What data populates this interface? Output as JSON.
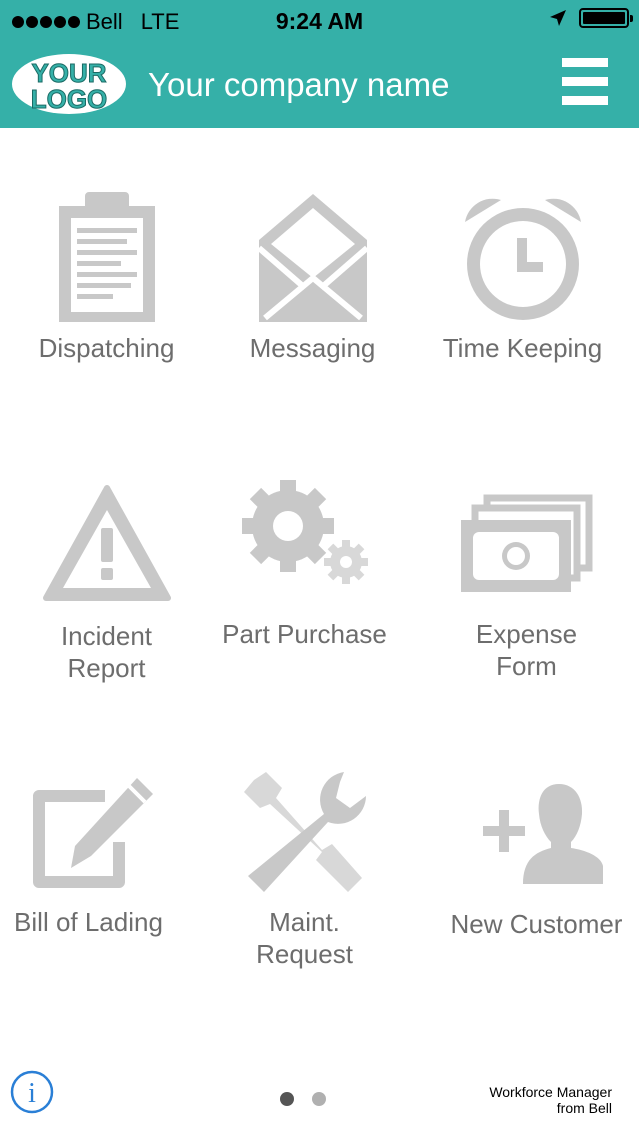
{
  "status_bar": {
    "carrier": "Bell",
    "network": "LTE",
    "time": "9:24 AM"
  },
  "header": {
    "logo_line1": "YOUR",
    "logo_line2": "LOGO",
    "company_name": "Your company name",
    "menu_icon": "hamburger-menu-icon"
  },
  "tiles": [
    {
      "icon": "clipboard-icon",
      "label_line1": "Dispatching",
      "label_line2": ""
    },
    {
      "icon": "envelope-icon",
      "label_line1": "Messaging",
      "label_line2": ""
    },
    {
      "icon": "alarm-clock-icon",
      "label_line1": "Time Keeping",
      "label_line2": ""
    },
    {
      "icon": "warning-icon",
      "label_line1": "Incident",
      "label_line2": "Report"
    },
    {
      "icon": "gears-icon",
      "label_line1": "Part Purchase",
      "label_line2": ""
    },
    {
      "icon": "money-icon",
      "label_line1": "Expense",
      "label_line2": "Form"
    },
    {
      "icon": "edit-icon",
      "label_line1": "Bill of Lading",
      "label_line2": ""
    },
    {
      "icon": "tools-icon",
      "label_line1": "Maint.",
      "label_line2": "Request"
    },
    {
      "icon": "add-user-icon",
      "label_line1": "New Customer",
      "label_line2": ""
    }
  ],
  "footer": {
    "line1": "Workforce Manager",
    "line2": "from Bell",
    "info_glyph": "i",
    "page_count": 2,
    "active_page": 1
  },
  "colors": {
    "header": "#35b0a8",
    "icon_gray": "#c8c8c8",
    "label_gray": "#6d6d6d",
    "info_blue": "#2a7fd6",
    "active_dot": "#555555",
    "inactive_dot": "#b0b0b0"
  }
}
